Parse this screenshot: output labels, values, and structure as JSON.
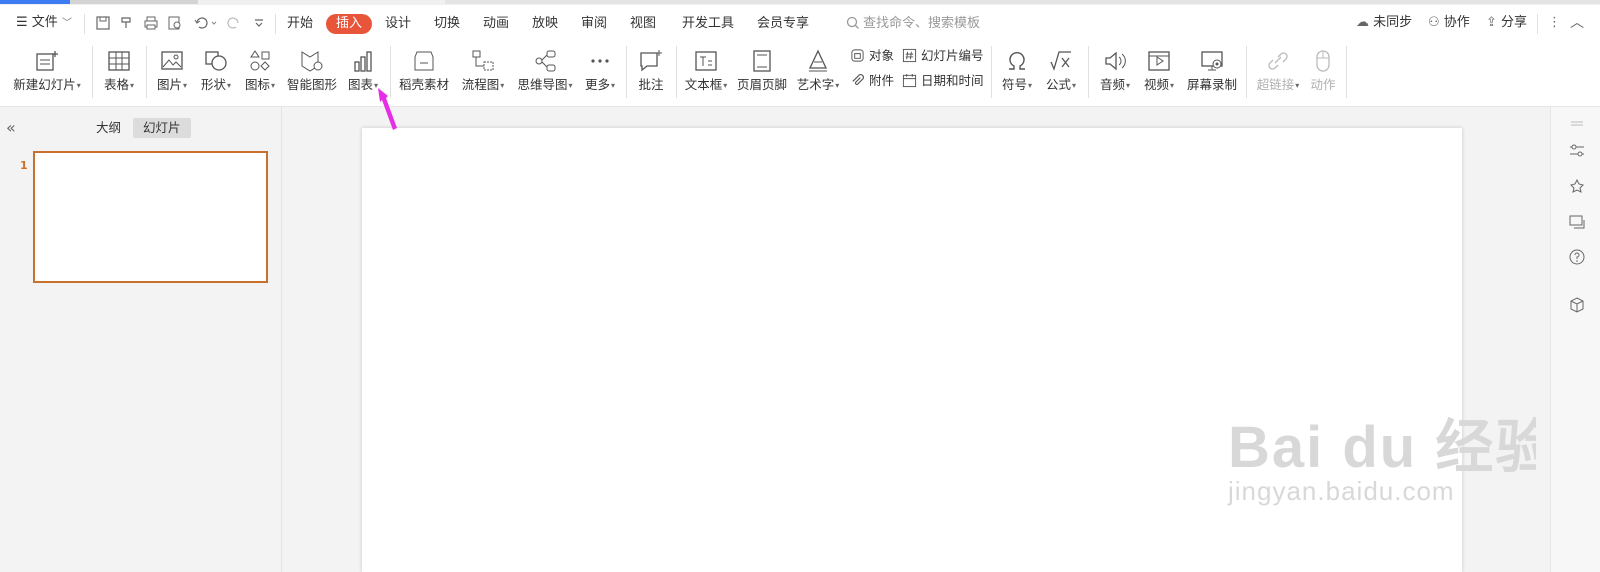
{
  "menu": {
    "file_label": "文件",
    "tabs": [
      "开始",
      "插入",
      "设计",
      "切换",
      "动画",
      "放映",
      "审阅",
      "视图",
      "开发工具",
      "会员专享"
    ],
    "active_tab": "插入",
    "search_placeholder": "查找命令、搜索模板",
    "right": {
      "sync": "未同步",
      "collab": "协作",
      "share": "分享"
    }
  },
  "ribbon": {
    "new_slide": "新建幻灯片",
    "table": "表格",
    "picture": "图片",
    "shape": "形状",
    "icon": "图标",
    "smartart": "智能图形",
    "chart": "图表",
    "material": "稻壳素材",
    "flowchart": "流程图",
    "mindmap": "思维导图",
    "more": "更多",
    "comment": "批注",
    "textbox": "文本框",
    "header_footer": "页眉页脚",
    "wordart": "艺术字",
    "object": "对象",
    "attachment": "附件",
    "slide_number": "幻灯片编号",
    "datetime": "日期和时间",
    "symbol": "符号",
    "formula": "公式",
    "audio": "音频",
    "video": "视频",
    "screen_record": "屏幕录制",
    "hyperlink": "超链接",
    "action": "动作"
  },
  "panel": {
    "tab_outline": "大纲",
    "tab_slides": "幻灯片",
    "slide_number": "1"
  },
  "watermark": {
    "big": "Bai du 经验",
    "small": "jingyan.baidu.com"
  },
  "colors": {
    "accent": "#e8553a",
    "selection": "#c8702c",
    "arrow": "#e62ee6"
  }
}
